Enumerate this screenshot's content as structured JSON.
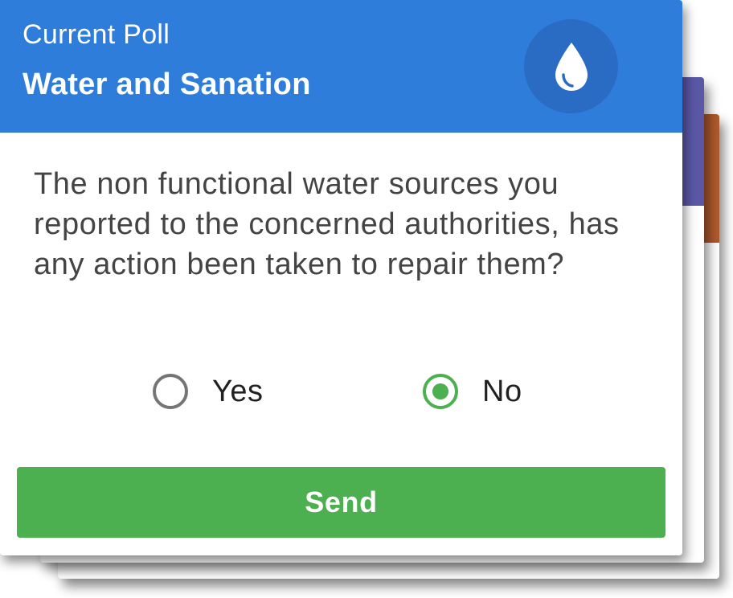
{
  "colors": {
    "header_bg": "#2f7ddb",
    "icon_circle": "#2a6bc4",
    "accent_green": "#4caf50",
    "stack_purple": "#5a57a6",
    "stack_orange": "#b05a2c"
  },
  "header": {
    "kicker": "Current Poll",
    "title": "Water and Sanation",
    "icon": "water-drop-icon"
  },
  "poll": {
    "question": "The non functional water sources you reported to the concerned authorities, has any action been taken to repair them?",
    "options": [
      {
        "label": "Yes",
        "selected": false
      },
      {
        "label": "No",
        "selected": true
      }
    ]
  },
  "actions": {
    "send_label": "Send"
  }
}
